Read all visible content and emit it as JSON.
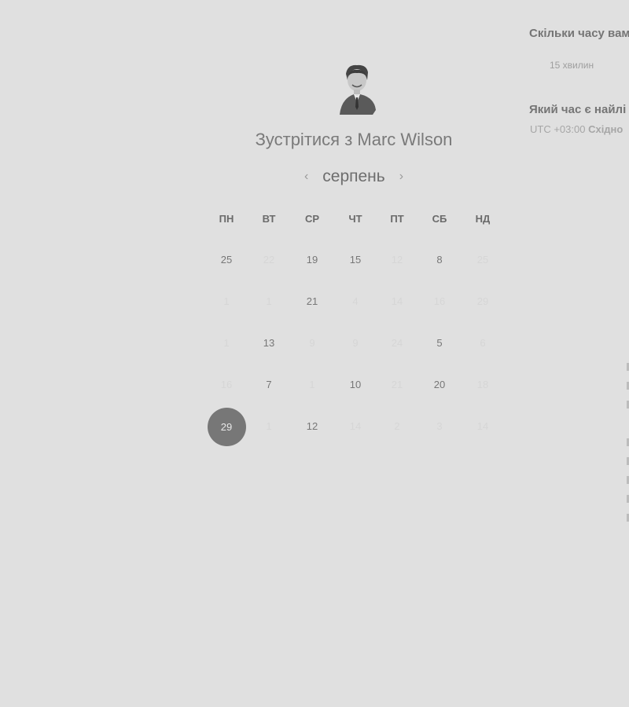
{
  "header": {
    "title": "Зустрітися з Marc Wilson"
  },
  "calendar": {
    "month": "серпень",
    "prev_icon": "chevron-left-icon",
    "next_icon": "chevron-right-icon",
    "weekdays": [
      "ПН",
      "ВТ",
      "СР",
      "ЧТ",
      "ПТ",
      "СБ",
      "НД"
    ],
    "weeks": [
      [
        {
          "d": "25",
          "a": true
        },
        {
          "d": "22",
          "a": false
        },
        {
          "d": "19",
          "a": true
        },
        {
          "d": "15",
          "a": true
        },
        {
          "d": "12",
          "a": false
        },
        {
          "d": "8",
          "a": true
        },
        {
          "d": "25",
          "a": false
        }
      ],
      [
        {
          "d": "1",
          "a": false
        },
        {
          "d": "1",
          "a": false
        },
        {
          "d": "21",
          "a": true
        },
        {
          "d": "4",
          "a": false
        },
        {
          "d": "14",
          "a": false
        },
        {
          "d": "16",
          "a": false
        },
        {
          "d": "29",
          "a": false
        }
      ],
      [
        {
          "d": "1",
          "a": false
        },
        {
          "d": "13",
          "a": true
        },
        {
          "d": "9",
          "a": false
        },
        {
          "d": "9",
          "a": false
        },
        {
          "d": "24",
          "a": false
        },
        {
          "d": "5",
          "a": true
        },
        {
          "d": "6",
          "a": false
        }
      ],
      [
        {
          "d": "16",
          "a": false
        },
        {
          "d": "7",
          "a": true
        },
        {
          "d": "1",
          "a": false
        },
        {
          "d": "10",
          "a": true
        },
        {
          "d": "21",
          "a": false
        },
        {
          "d": "20",
          "a": true
        },
        {
          "d": "18",
          "a": false
        }
      ],
      [
        {
          "d": "29",
          "a": true,
          "selected": true
        },
        {
          "d": "1",
          "a": false
        },
        {
          "d": "12",
          "a": true
        },
        {
          "d": "14",
          "a": false
        },
        {
          "d": "2",
          "a": false
        },
        {
          "d": "3",
          "a": false
        },
        {
          "d": "14",
          "a": false
        }
      ]
    ],
    "selected_color": "#777777"
  },
  "side": {
    "duration_question": "Скільки часу вам",
    "duration_value": "15 хвилин",
    "time_question": "Який час є найлі",
    "timezone_offset": "UTC +03:00",
    "timezone_name": "Східно"
  }
}
